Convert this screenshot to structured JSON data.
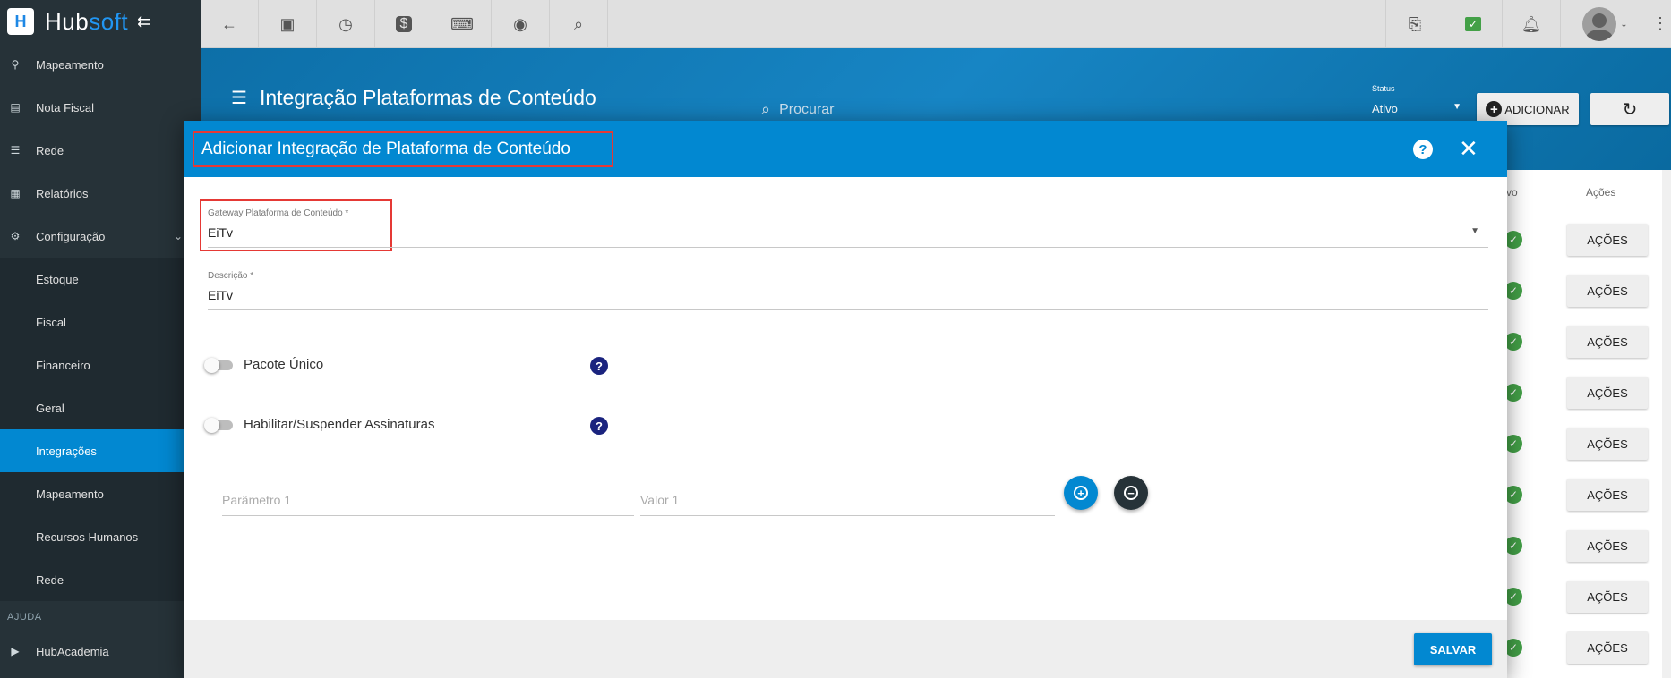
{
  "app": {
    "brand_part1": "Hub",
    "brand_part2": "soft"
  },
  "sidebar": {
    "items": [
      {
        "label": "Mapeamento",
        "icon": "map-pin-icon"
      },
      {
        "label": "Nota Fiscal",
        "icon": "document-icon"
      },
      {
        "label": "Rede",
        "icon": "server-icon"
      },
      {
        "label": "Relatórios",
        "icon": "report-icon"
      },
      {
        "label": "Configuração",
        "icon": "gear-icon"
      }
    ],
    "sub_items": [
      {
        "label": "Estoque"
      },
      {
        "label": "Fiscal"
      },
      {
        "label": "Financeiro"
      },
      {
        "label": "Geral"
      },
      {
        "label": "Integrações",
        "active": true
      },
      {
        "label": "Mapeamento"
      },
      {
        "label": "Recursos Humanos"
      },
      {
        "label": "Rede"
      }
    ],
    "section_help": "AJUDA",
    "help_items": [
      {
        "label": "HubAcademia",
        "icon": "play-icon"
      }
    ]
  },
  "topbar": {
    "icons": [
      "back-arrow-icon",
      "contact-card-icon",
      "calendar-clock-icon",
      "dollar-icon",
      "terminal-icon",
      "eye-icon",
      "search-icon"
    ],
    "right_icons": [
      "pdf-icon",
      "chat-check-icon",
      "bell-icon"
    ]
  },
  "page": {
    "title": "Integração Plataformas de Conteúdo",
    "search_placeholder": "Procurar",
    "status_label": "Status",
    "status_value": "Ativo",
    "add_label": "ADICIONAR"
  },
  "table": {
    "col_ativo": "tivo",
    "col_acoes": "Ações",
    "row_action_label": "AÇÕES",
    "row_count": 9
  },
  "modal": {
    "title": "Adicionar Integração de Plataforma de Conteúdo",
    "gateway_label": "Gateway Plataforma de Conteúdo *",
    "gateway_value": "EiTv",
    "descricao_label": "Descrição *",
    "descricao_value": "EiTv",
    "toggle_pacote": "Pacote Único",
    "toggle_assinaturas": "Habilitar/Suspender Assinaturas",
    "param_placeholder": "Parâmetro 1",
    "valor_placeholder": "Valor 1",
    "save_label": "SALVAR"
  },
  "colors": {
    "primary": "#0288d1",
    "sidebar_bg": "#263238",
    "highlight_red": "#e53935",
    "success": "#43a047",
    "dark_button": "#263238",
    "help_icon": "#1a237e"
  }
}
